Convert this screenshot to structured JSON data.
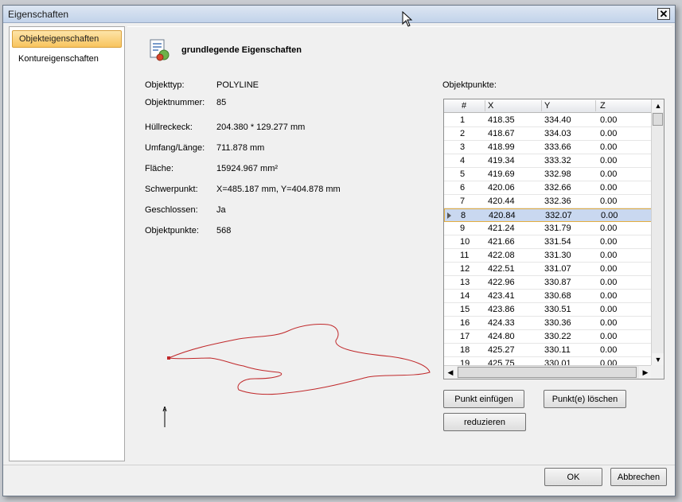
{
  "window": {
    "title": "Eigenschaften",
    "close_label": "✕"
  },
  "sidebar": {
    "items": [
      {
        "label": "Objekteigenschaften",
        "active": true
      },
      {
        "label": "Kontureigenschaften",
        "active": false
      }
    ]
  },
  "header": {
    "title": "grundlegende Eigenschaften",
    "icon": "properties-document-icon"
  },
  "properties": [
    {
      "label": "Objekttyp:",
      "value": "POLYLINE"
    },
    {
      "label": "Objektnummer:",
      "value": "85"
    },
    {
      "label": "Hüllreckeck:",
      "value": "204.380 * 129.277 mm"
    },
    {
      "label": "Umfang/Länge:",
      "value": "711.878 mm"
    },
    {
      "label": "Fläche:",
      "value": "15924.967 mm²"
    },
    {
      "label": "Schwerpunkt:",
      "value": "X=485.187 mm, Y=404.878 mm"
    },
    {
      "label": "Geschlossen:",
      "value": "Ja"
    },
    {
      "label": "Objektpunkte:",
      "value": "568"
    }
  ],
  "points": {
    "label": "Objektpunkte:",
    "columns": [
      "#",
      "X",
      "Y",
      "Z"
    ],
    "selected_index": 7,
    "rows": [
      [
        "1",
        "418.35",
        "334.40",
        "0.00"
      ],
      [
        "2",
        "418.67",
        "334.03",
        "0.00"
      ],
      [
        "3",
        "418.99",
        "333.66",
        "0.00"
      ],
      [
        "4",
        "419.34",
        "333.32",
        "0.00"
      ],
      [
        "5",
        "419.69",
        "332.98",
        "0.00"
      ],
      [
        "6",
        "420.06",
        "332.66",
        "0.00"
      ],
      [
        "7",
        "420.44",
        "332.36",
        "0.00"
      ],
      [
        "8",
        "420.84",
        "332.07",
        "0.00"
      ],
      [
        "9",
        "421.24",
        "331.79",
        "0.00"
      ],
      [
        "10",
        "421.66",
        "331.54",
        "0.00"
      ],
      [
        "11",
        "422.08",
        "331.30",
        "0.00"
      ],
      [
        "12",
        "422.51",
        "331.07",
        "0.00"
      ],
      [
        "13",
        "422.96",
        "330.87",
        "0.00"
      ],
      [
        "14",
        "423.41",
        "330.68",
        "0.00"
      ],
      [
        "15",
        "423.86",
        "330.51",
        "0.00"
      ],
      [
        "16",
        "424.33",
        "330.36",
        "0.00"
      ],
      [
        "17",
        "424.80",
        "330.22",
        "0.00"
      ],
      [
        "18",
        "425.27",
        "330.11",
        "0.00"
      ],
      [
        "19",
        "425.75",
        "330.01",
        "0.00"
      ]
    ]
  },
  "buttons": {
    "insert_point": "Punkt einfügen",
    "delete_points": "Punkt(e) löschen",
    "reduce": "reduzieren",
    "ok": "OK",
    "cancel": "Abbrechen"
  },
  "colors": {
    "contour": "#c0282a",
    "selection_border": "#e3ad40",
    "active_tab": "#f8c45e"
  }
}
